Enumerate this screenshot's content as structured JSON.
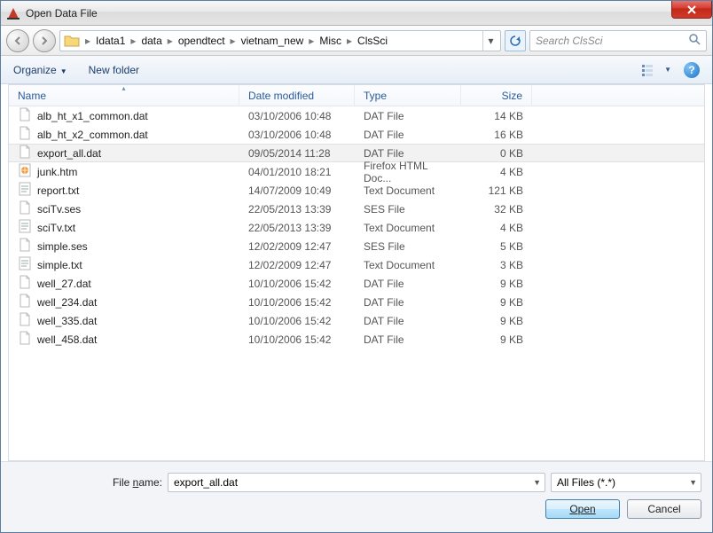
{
  "window": {
    "title": "Open Data File"
  },
  "nav": {
    "crumbs": [
      "Idata1",
      "data",
      "opendtect",
      "vietnam_new",
      "Misc",
      "ClsSci"
    ],
    "searchPlaceholder": "Search ClsSci"
  },
  "toolbar": {
    "organize": "Organize",
    "newfolder": "New folder"
  },
  "columns": {
    "name": "Name",
    "date": "Date modified",
    "type": "Type",
    "size": "Size"
  },
  "files": [
    {
      "icon": "file",
      "name": "alb_ht_x1_common.dat",
      "date": "03/10/2006 10:48",
      "type": "DAT File",
      "size": "14 KB",
      "selected": false
    },
    {
      "icon": "file",
      "name": "alb_ht_x2_common.dat",
      "date": "03/10/2006 10:48",
      "type": "DAT File",
      "size": "16 KB",
      "selected": false
    },
    {
      "icon": "file",
      "name": "export_all.dat",
      "date": "09/05/2014 11:28",
      "type": "DAT File",
      "size": "0 KB",
      "selected": true
    },
    {
      "icon": "html",
      "name": "junk.htm",
      "date": "04/01/2010 18:21",
      "type": "Firefox HTML Doc...",
      "size": "4 KB",
      "selected": false
    },
    {
      "icon": "text",
      "name": "report.txt",
      "date": "14/07/2009 10:49",
      "type": "Text Document",
      "size": "121 KB",
      "selected": false
    },
    {
      "icon": "file",
      "name": "sciTv.ses",
      "date": "22/05/2013 13:39",
      "type": "SES File",
      "size": "32 KB",
      "selected": false
    },
    {
      "icon": "text",
      "name": "sciTv.txt",
      "date": "22/05/2013 13:39",
      "type": "Text Document",
      "size": "4 KB",
      "selected": false
    },
    {
      "icon": "file",
      "name": "simple.ses",
      "date": "12/02/2009 12:47",
      "type": "SES File",
      "size": "5 KB",
      "selected": false
    },
    {
      "icon": "text",
      "name": "simple.txt",
      "date": "12/02/2009 12:47",
      "type": "Text Document",
      "size": "3 KB",
      "selected": false
    },
    {
      "icon": "file",
      "name": "well_27.dat",
      "date": "10/10/2006 15:42",
      "type": "DAT File",
      "size": "9 KB",
      "selected": false
    },
    {
      "icon": "file",
      "name": "well_234.dat",
      "date": "10/10/2006 15:42",
      "type": "DAT File",
      "size": "9 KB",
      "selected": false
    },
    {
      "icon": "file",
      "name": "well_335.dat",
      "date": "10/10/2006 15:42",
      "type": "DAT File",
      "size": "9 KB",
      "selected": false
    },
    {
      "icon": "file",
      "name": "well_458.dat",
      "date": "10/10/2006 15:42",
      "type": "DAT File",
      "size": "9 KB",
      "selected": false
    }
  ],
  "bottom": {
    "filenameLabel": "File name:",
    "filenameValue": "export_all.dat",
    "filter": "All Files (*.*)",
    "open": "Open",
    "cancel": "Cancel"
  }
}
